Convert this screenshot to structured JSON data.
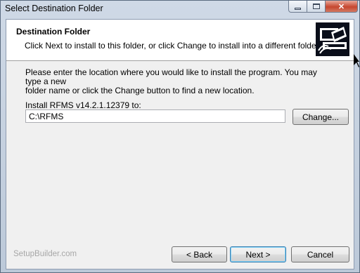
{
  "window": {
    "title": "Select Destination Folder"
  },
  "header": {
    "title": "Destination Folder",
    "subtitle": "Click Next to install to this folder, or click Change to install into a different folder."
  },
  "body": {
    "line1": "Please enter the location where you would like to install the program. You may type a new",
    "line2": "folder name or click the Change button to find a new location.",
    "install_label": "Install RFMS v14.2.1.12379 to:",
    "path_value": "C:\\RFMS"
  },
  "buttons": {
    "change": "Change...",
    "back": "< Back",
    "next": "Next >",
    "cancel": "Cancel"
  },
  "footer": {
    "brand": "SetupBuilder.com"
  },
  "icons": {
    "header": "installer-computer-icon",
    "close": "close-icon",
    "minimize": "minimize-icon",
    "maximize": "maximize-icon"
  }
}
